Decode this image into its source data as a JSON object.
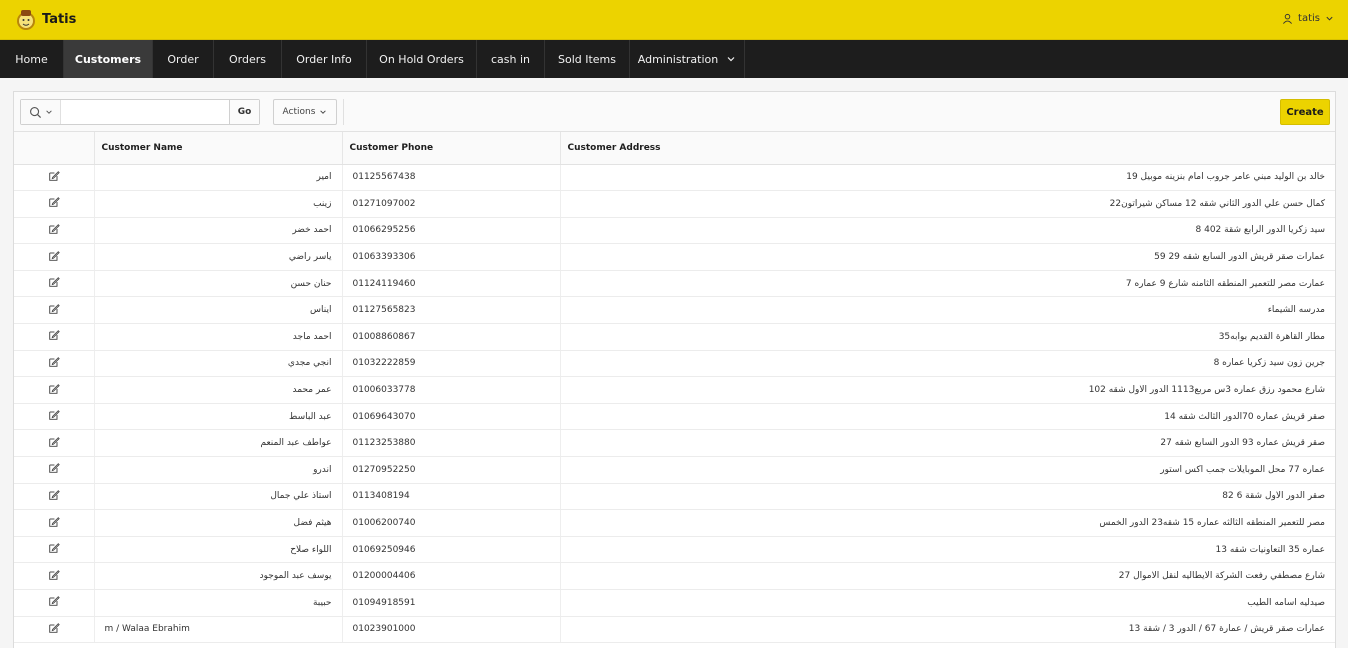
{
  "app": {
    "title": "Tatis",
    "user": "tatis"
  },
  "nav": {
    "items": [
      {
        "label": "Home"
      },
      {
        "label": "Customers"
      },
      {
        "label": "Order"
      },
      {
        "label": "Orders"
      },
      {
        "label": "Order Info"
      },
      {
        "label": "On Hold Orders"
      },
      {
        "label": "cash in"
      },
      {
        "label": "Sold Items"
      },
      {
        "label": "Administration"
      }
    ],
    "active": "Customers"
  },
  "toolbar": {
    "search_value": "",
    "go_label": "Go",
    "actions_label": "Actions",
    "create_label": "Create"
  },
  "table": {
    "columns": [
      "Customer Name",
      "Customer Phone",
      "Customer Address"
    ],
    "rows": [
      {
        "name": "امير",
        "phone": "01125567438",
        "address": "خالد بن الوليد مبني عامر جروب امام بنزينه موبيل 19"
      },
      {
        "name": "زينب",
        "phone": "01271097002",
        "address": "كمال حسن علي الدور الثاني شقه 12 مساكن شيراتون22"
      },
      {
        "name": "احمد خضر",
        "phone": "01066295256",
        "address": "سيد زكريا الدور الرابع شقة 402 8"
      },
      {
        "name": "ياسر راضي",
        "phone": "01063393306",
        "address": "عمارات صقر قريش الدور السابع شقه 29 59"
      },
      {
        "name": "حنان حسن",
        "phone": "01124119460",
        "address": "عمارت مصر للتعمير المنطقه الثامنه شارع 9 عماره 7"
      },
      {
        "name": "ايناس",
        "phone": "01127565823",
        "address": "مدرسه الشيماء"
      },
      {
        "name": "احمد ماجد",
        "phone": "01008860867",
        "address": "مطار القاهرة القديم بوابه35"
      },
      {
        "name": "انجي مجدي",
        "phone": "01032222859",
        "address": "جرين زون سيد زكريا عماره 8"
      },
      {
        "name": "عمر محمد",
        "phone": "01006033778",
        "address": "شارع محمود رزق عماره 3س مربع1113 الدور الاول شقه 102"
      },
      {
        "name": "عبد الباسط",
        "phone": "01069643070",
        "address": "صقر قريش عماره 70الدور الثالث شقه 14"
      },
      {
        "name": "عواطف عبد المنعم",
        "phone": "01123253880",
        "address": "صقر قريش عماره 93 الدور السابع شقه 27"
      },
      {
        "name": "اندرو",
        "phone": "01270952250",
        "address": "عماره 77 محل الموبايلات جمب اكس استور"
      },
      {
        "name": "استاذ علي جمال",
        "phone": "0113408194",
        "address": "صقر الدور الاول شقة 6 82"
      },
      {
        "name": "هيثم فضل",
        "phone": "01006200740",
        "address": "مصر للتعمير المنطقه الثالثه عماره 15 شقه23 الدور الخمس"
      },
      {
        "name": "اللواء صلاح",
        "phone": "01069250946",
        "address": "عماره 35 التعاونيات شقه 13"
      },
      {
        "name": "يوسف عبد الموجود",
        "phone": "01200004406",
        "address": "شارع مصطفي رفعت الشركة الايطاليه لنقل الاموال 27"
      },
      {
        "name": "حبيبة",
        "phone": "01094918591",
        "address": "صيدليه اسامه الطيب"
      },
      {
        "name": "m / Walaa Ebrahim",
        "phone": "01023901000",
        "address": "عمارات صقر قريش / عمارة 67 / الدور 3 / شقة 13"
      }
    ]
  },
  "colors": {
    "accent": "#ecd300",
    "nav_bg": "#1d1d1d"
  }
}
